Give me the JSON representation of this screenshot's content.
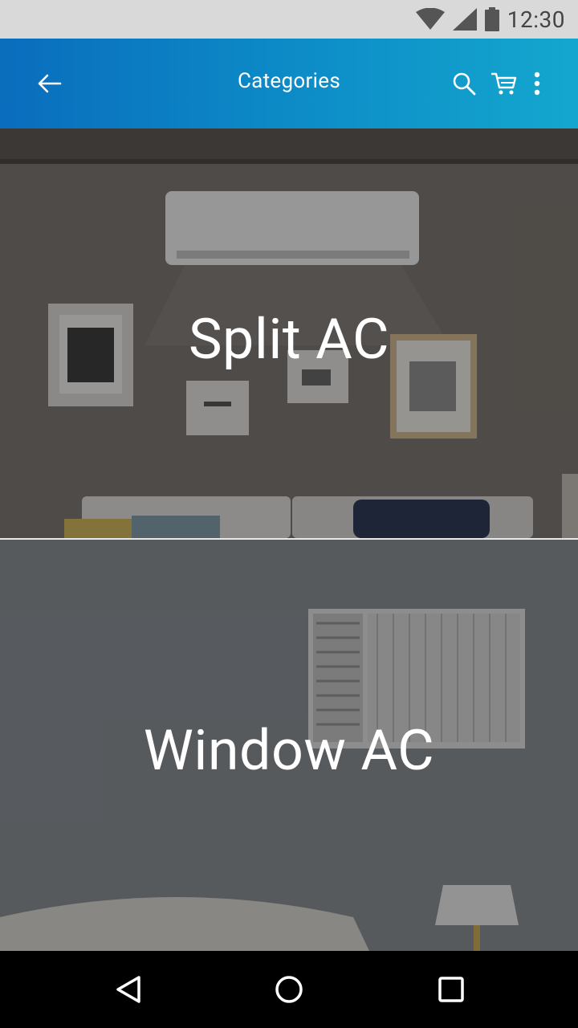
{
  "status_bar": {
    "time": "12:30",
    "icons": [
      "wifi-icon",
      "cellular-signal-icon",
      "battery-icon"
    ]
  },
  "app_bar": {
    "title": "Categories",
    "actions": [
      "search-icon",
      "cart-icon",
      "more-vert-icon"
    ],
    "gradient": [
      "#0a6dbd",
      "#14a7ce"
    ]
  },
  "categories": [
    {
      "label": "Split AC",
      "image": "split-ac-living-room-photo"
    },
    {
      "label": "Window AC",
      "image": "window-ac-bedroom-photo"
    }
  ],
  "nav_bar": {
    "buttons": [
      "back-triangle-icon",
      "home-circle-icon",
      "recents-square-icon"
    ]
  }
}
